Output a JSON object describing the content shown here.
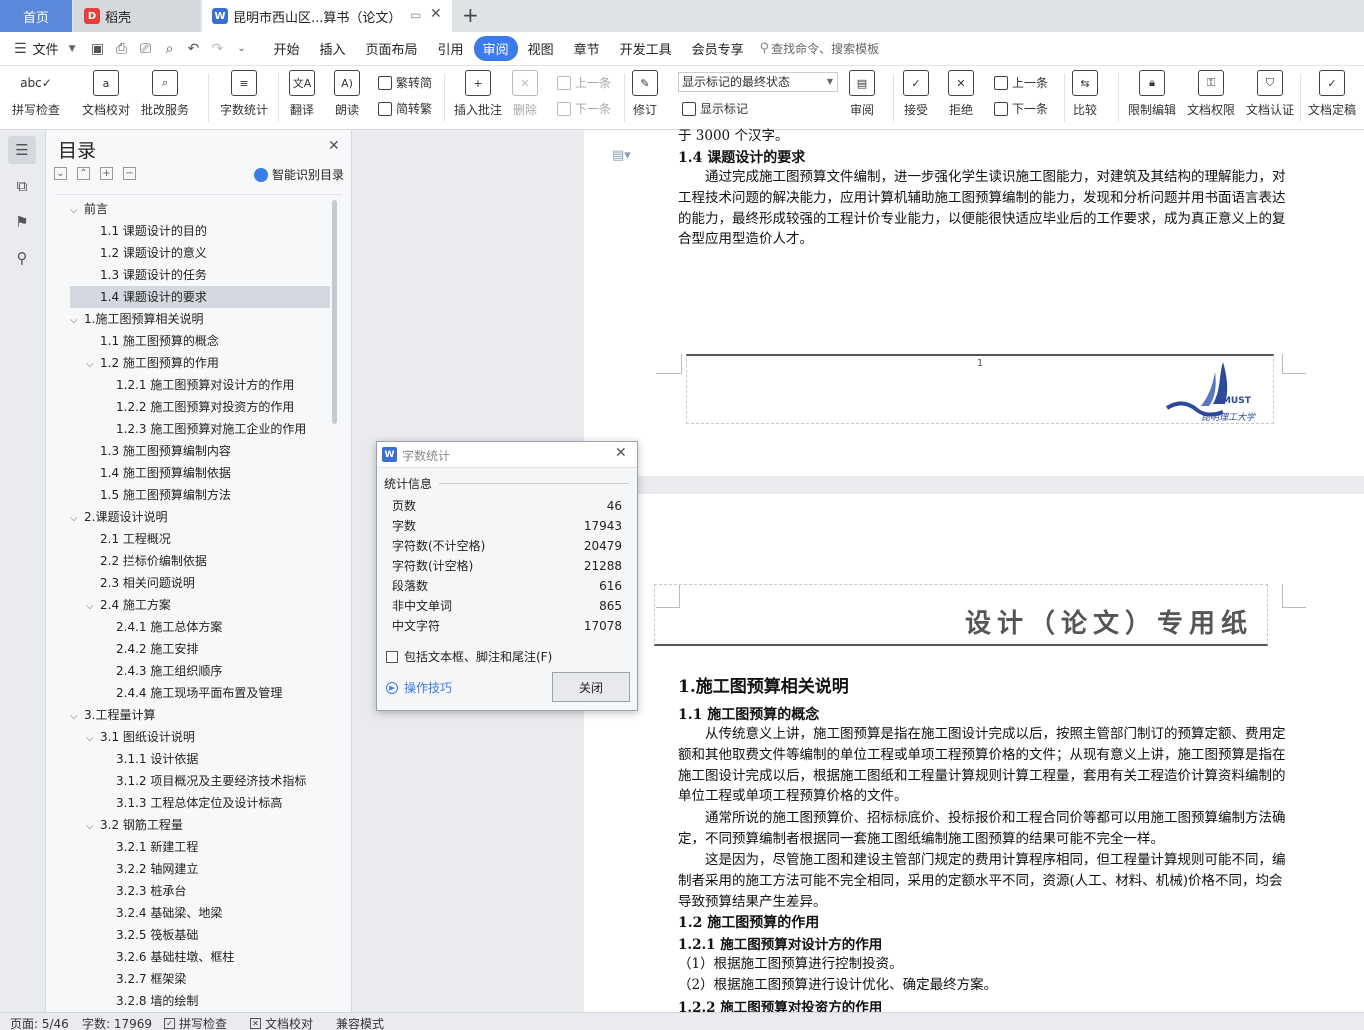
{
  "tabs": {
    "home": "首页",
    "daoke": "稻壳",
    "doc": "昆明市西山区...算书（论文）"
  },
  "menubar": {
    "file": "文件",
    "items": [
      "开始",
      "插入",
      "页面布局",
      "引用",
      "审阅",
      "视图",
      "章节",
      "开发工具",
      "会员专享"
    ],
    "search": "查找命令、搜索模板"
  },
  "ribbon": {
    "spellcheck": "拼写检查",
    "doc_proof": "文档校对",
    "batch_service": "批改服务",
    "word_count": "字数统计",
    "translate": "翻译",
    "read_aloud": "朗读",
    "trad_to_simp": "繁转简",
    "simp_to_trad": "简转繁",
    "insert_comment": "插入批注",
    "delete": "删除",
    "prev_comment": "上一条",
    "next_comment": "下一条",
    "revise": "修订",
    "markup_state": "显示标记的最终状态",
    "show_markup": "显示标记",
    "review": "审阅",
    "accept": "接受",
    "reject": "拒绝",
    "prev_change": "上一条",
    "next_change": "下一条",
    "compare": "比较",
    "restrict_edit": "限制编辑",
    "doc_rights": "文档权限",
    "doc_cert": "文档认证",
    "doc_finalize": "文档定稿"
  },
  "toc": {
    "title": "目录",
    "smart": "智能识别目录",
    "items": [
      {
        "text": "前言",
        "level": 0,
        "caret": "v"
      },
      {
        "text": "1.1 课题设计的目的",
        "level": 1
      },
      {
        "text": "1.2 课题设计的意义",
        "level": 1
      },
      {
        "text": "1.3 课题设计的任务",
        "level": 1
      },
      {
        "text": "1.4 课题设计的要求",
        "level": 1,
        "selected": true
      },
      {
        "text": "1.施工图预算相关说明",
        "level": 0,
        "caret": "v"
      },
      {
        "text": "1.1 施工图预算的概念",
        "level": 1
      },
      {
        "text": "1.2 施工图预算的作用",
        "level": 1,
        "caret": "v"
      },
      {
        "text": "1.2.1 施工图预算对设计方的作用",
        "level": 2
      },
      {
        "text": "1.2.2 施工图预算对投资方的作用",
        "level": 2
      },
      {
        "text": "1.2.3 施工图预算对施工企业的作用",
        "level": 2
      },
      {
        "text": "1.3 施工图预算编制内容",
        "level": 1
      },
      {
        "text": "1.4 施工图预算编制依据",
        "level": 1
      },
      {
        "text": "1.5 施工图预算编制方法",
        "level": 1
      },
      {
        "text": "2.课题设计说明",
        "level": 0,
        "caret": "v"
      },
      {
        "text": "2.1 工程概况",
        "level": 1
      },
      {
        "text": "2.2 拦标价编制依据",
        "level": 1
      },
      {
        "text": "2.3 相关问题说明",
        "level": 1
      },
      {
        "text": "2.4 施工方案",
        "level": 1,
        "caret": "v"
      },
      {
        "text": "2.4.1 施工总体方案",
        "level": 2
      },
      {
        "text": "2.4.2 施工安排",
        "level": 2
      },
      {
        "text": "2.4.3 施工组织顺序",
        "level": 2
      },
      {
        "text": "2.4.4 施工现场平面布置及管理",
        "level": 2
      },
      {
        "text": "3.工程量计算",
        "level": 0,
        "caret": "v"
      },
      {
        "text": "3.1 图纸设计说明",
        "level": 1,
        "caret": "v"
      },
      {
        "text": "3.1.1 设计依据",
        "level": 2
      },
      {
        "text": "3.1.2 项目概况及主要经济技术指标",
        "level": 2
      },
      {
        "text": "3.1.3 工程总体定位及设计标高",
        "level": 2
      },
      {
        "text": "3.2 钢筋工程量",
        "level": 1,
        "caret": "v"
      },
      {
        "text": "3.2.1 新建工程",
        "level": 2
      },
      {
        "text": "3.2.2 轴网建立",
        "level": 2
      },
      {
        "text": "3.2.3 桩承台",
        "level": 2
      },
      {
        "text": "3.2.4 基础梁、地梁",
        "level": 2
      },
      {
        "text": "3.2.5 筏板基础",
        "level": 2
      },
      {
        "text": "3.2.6 基础柱墩、框柱",
        "level": 2
      },
      {
        "text": "3.2.7 框架梁",
        "level": 2
      },
      {
        "text": "3.2.8 墙的绘制",
        "level": 2
      }
    ]
  },
  "document": {
    "p1_top": "于 3000 个汉字。",
    "h_14": "1.4 课题设计的要求",
    "p_14": "通过完成施工图预算文件编制，进一步强化学生读识施工图能力，对建筑及其结构的理解能力，对工程技术问题的解决能力，应用计算机辅助施工图预算编制的能力，发现和分析问题并用书面语言表达的能力，最终形成较强的工程计价专业能力，以便能很快适应毕业后的工作要求，成为真正意义上的复合型应用型造价人才。",
    "page_number": "1",
    "logo_text": "KMUST",
    "logo_sub": "昆明理工大学",
    "header_title": "设计（论文）专用纸",
    "h1": "1.施工图预算相关说明",
    "h_11": "1.1 施工图预算的概念",
    "p_11a": "从传统意义上讲，施工图预算是指在施工图设计完成以后，按照主管部门制订的预算定额、费用定额和其他取费文件等编制的单位工程或单项工程预算价格的文件；从现有意义上讲，施工图预算是指在施工图设计完成以后，根据施工图纸和工程量计算规则计算工程量，套用有关工程造价计算资料编制的单位工程或单项工程预算价格的文件。",
    "p_11b": "通常所说的施工图预算价、招标标底价、投标报价和工程合同价等都可以用施工图预算编制方法确定，不同预算编制者根据同一套施工图纸编制施工图预算的结果可能不完全一样。",
    "p_11c": "这是因为，尽管施工图和建设主管部门规定的费用计算程序相同，但工程量计算规则可能不同，编制者采用的施工方法可能不完全相同，采用的定额水平不同，资源(人工、材料、机械)价格不同，均会导致预算结果产生差异。",
    "h_12": "1.2 施工图预算的作用",
    "h_121": "1.2.1 施工图预算对设计方的作用",
    "li_1": "（1）根据施工图预算进行控制投资。",
    "li_2": "（2）根据施工图预算进行设计优化、确定最终方案。",
    "h_122": "1.2.2 施工图预算对投资方的作用"
  },
  "dialog": {
    "title": "字数统计",
    "section": "统计信息",
    "rows": [
      {
        "label": "页数",
        "value": "46"
      },
      {
        "label": "字数",
        "value": "17943"
      },
      {
        "label": "字符数(不计空格)",
        "value": "20479"
      },
      {
        "label": "字符数(计空格)",
        "value": "21288"
      },
      {
        "label": "段落数",
        "value": "616"
      },
      {
        "label": "非中文单词",
        "value": "865"
      },
      {
        "label": "中文字符",
        "value": "17078"
      }
    ],
    "include_label": "包括文本框、脚注和尾注(F)",
    "tips": "操作技巧",
    "close": "关闭"
  },
  "status": {
    "page": "页面: 5/46",
    "words": "字数: 17969",
    "spell": "拼写检查",
    "proof": "文档校对",
    "mode": "兼容模式"
  },
  "colors": {
    "accent": "#3b7bea",
    "home_tab": "#5b87d8",
    "daoke_red": "#e8403a",
    "logo_blue": "#2c4a9a"
  }
}
